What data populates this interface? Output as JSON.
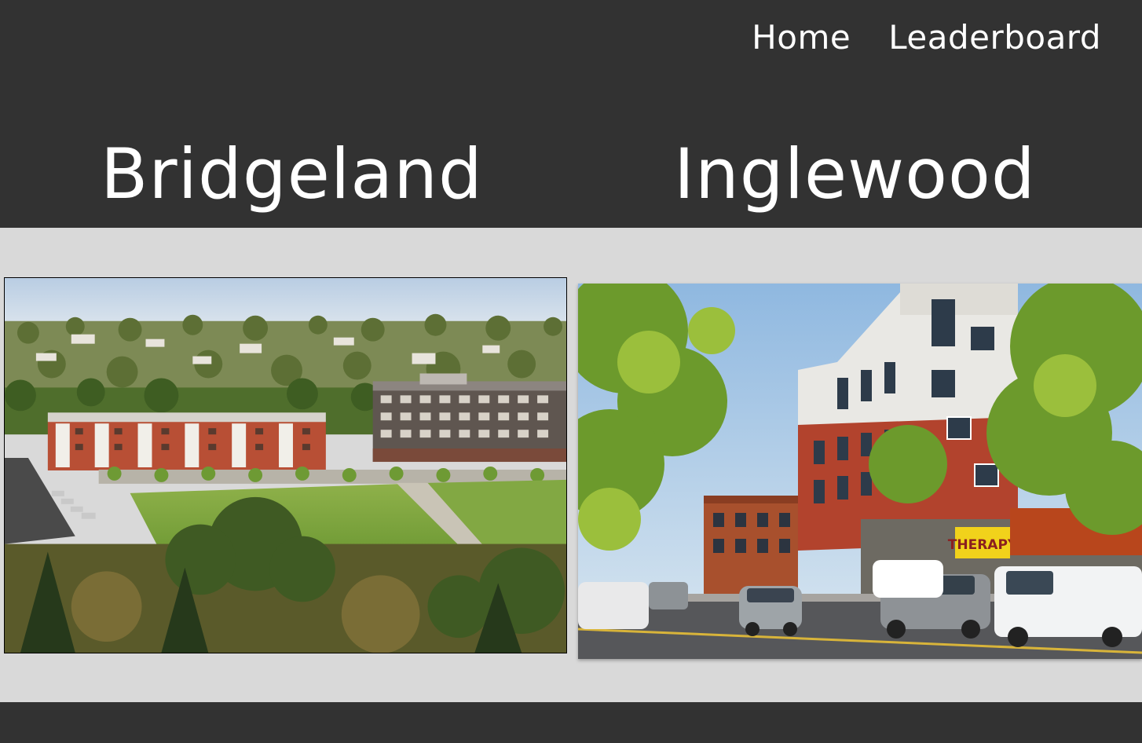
{
  "nav": {
    "home_label": "Home",
    "leaderboard_label": "Leaderboard"
  },
  "choices": [
    {
      "name": "Bridgeland",
      "photo": "bridgeland-aerial-photo"
    },
    {
      "name": "Inglewood",
      "photo": "inglewood-street-photo"
    }
  ],
  "photo_signs": {
    "storefront_sign": "THERAPY"
  },
  "colors": {
    "header_bg": "#323232",
    "body_bg": "#d9d9d9",
    "text": "#ffffff"
  }
}
